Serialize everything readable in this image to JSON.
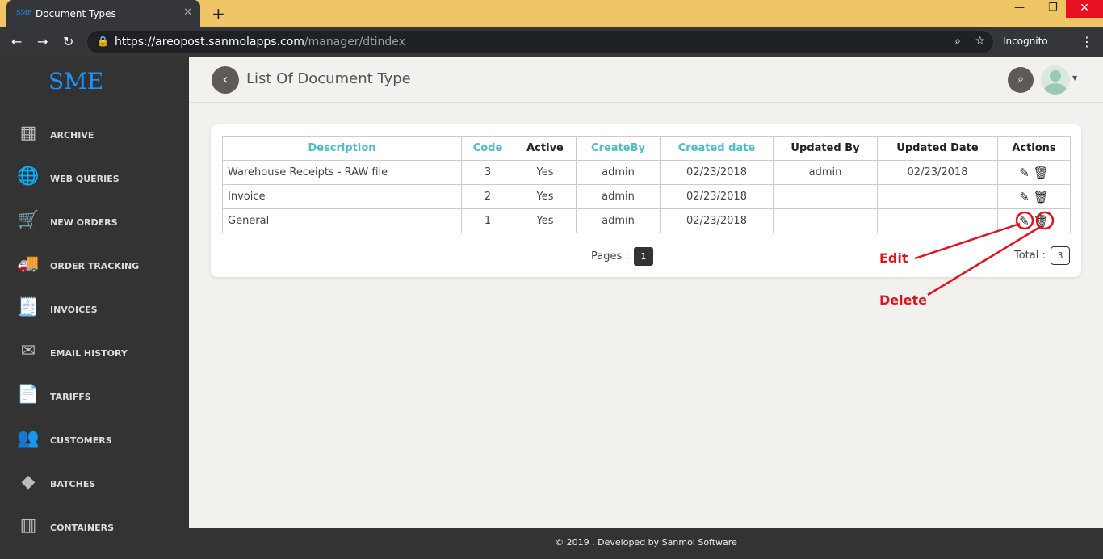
{
  "browser": {
    "tab_title": "Document Types",
    "favicon": "SME",
    "url_host": "https://areopost.sanmolapps.com",
    "url_path": "/manager/dtindex",
    "incognito": "Incognito"
  },
  "sidebar": {
    "logo": "SME",
    "items": [
      {
        "label": "ARCHIVE",
        "icon": "archive-icon",
        "glyph": "▦"
      },
      {
        "label": "WEB QUERIES",
        "icon": "globe-icon",
        "glyph": "🌐"
      },
      {
        "label": "NEW ORDERS",
        "icon": "cart-icon",
        "glyph": "🛒"
      },
      {
        "label": "ORDER TRACKING",
        "icon": "truck-icon",
        "glyph": "🚚"
      },
      {
        "label": "INVOICES",
        "icon": "invoice-icon",
        "glyph": "🧾"
      },
      {
        "label": "EMAIL HISTORY",
        "icon": "email-icon",
        "glyph": "✉"
      },
      {
        "label": "TARIFFS",
        "icon": "tariff-icon",
        "glyph": "📄"
      },
      {
        "label": "CUSTOMERS",
        "icon": "customers-icon",
        "glyph": "👥"
      },
      {
        "label": "BATCHES",
        "icon": "batches-icon",
        "glyph": "◆"
      },
      {
        "label": "CONTAINERS",
        "icon": "container-icon",
        "glyph": "▥"
      }
    ]
  },
  "header": {
    "title": "List Of Document Type"
  },
  "table": {
    "columns": [
      "Description",
      "Code",
      "Active",
      "CreateBy",
      "Created date",
      "Updated By",
      "Updated Date",
      "Actions"
    ],
    "rows": [
      [
        "Warehouse Receipts - RAW file",
        "3",
        "Yes",
        "admin",
        "02/23/2018",
        "admin",
        "02/23/2018"
      ],
      [
        "Invoice",
        "2",
        "Yes",
        "admin",
        "02/23/2018",
        "",
        ""
      ],
      [
        "General",
        "1",
        "Yes",
        "admin",
        "02/23/2018",
        "",
        ""
      ]
    ]
  },
  "pagination": {
    "label": "Pages :",
    "current": "1",
    "total_label": "Total :",
    "total": "3"
  },
  "annotations": {
    "edit": "Edit",
    "delete": "Delete",
    "color": "#e0141e"
  },
  "footer": "© 2019 , Developed by Sanmol Software"
}
